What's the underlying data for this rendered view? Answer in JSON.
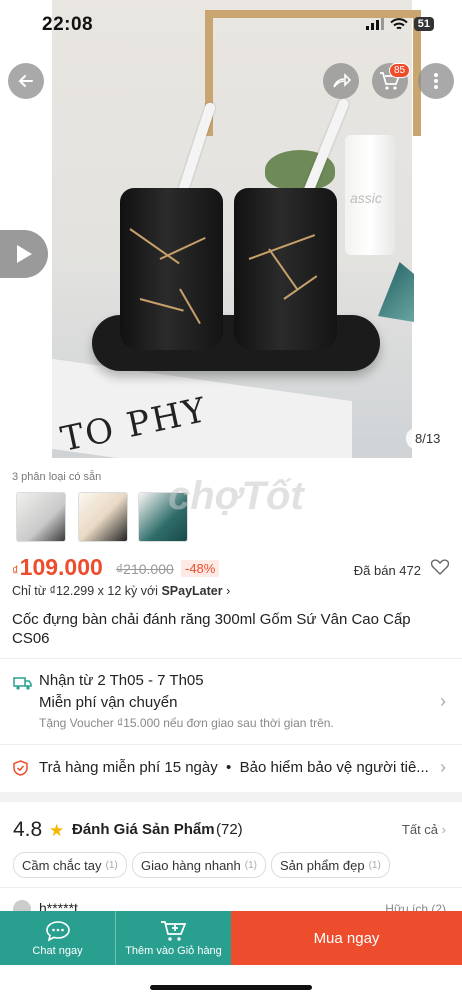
{
  "status_bar": {
    "time": "22:08",
    "battery": "51"
  },
  "gallery": {
    "counter": "8/13",
    "cart_badge": "85",
    "book_text": "TO PHY",
    "glass_text": "assic",
    "watermark": "chợTốt"
  },
  "variants": {
    "label": "3 phân loại có sẵn"
  },
  "price": {
    "currency": "₫",
    "current": "109.000",
    "original": "₫210.000",
    "discount": "-48%",
    "sold": "Đã bán 472"
  },
  "installment": {
    "prefix": "Chỉ từ ₫12.299 x 12 kỳ với ",
    "provider": "SPayLater",
    "arrow": "›"
  },
  "product": {
    "title": "Cốc đựng bàn chải đánh răng 300ml Gốm Sứ Vân Cao Cấp CS06"
  },
  "shipping": {
    "delivery": "Nhận từ 2 Th05 - 7 Th05",
    "free_ship": "Miễn phí vận chuyển",
    "voucher": "Tặng Voucher ₫15.000 nếu đơn giao sau thời gian trên."
  },
  "returns": {
    "text": "Trả hàng miễn phí 15 ngày  •  Bảo hiểm bảo vệ người tiê..."
  },
  "ratings": {
    "score": "4.8",
    "title": "Đánh Giá Sản Phẩm",
    "count": "(72)",
    "see_all": "Tất cả",
    "tags": [
      {
        "label": "Cầm chắc tay",
        "count": "(1)"
      },
      {
        "label": "Giao hàng nhanh",
        "count": "(1)"
      },
      {
        "label": "Sản phẩm đẹp",
        "count": "(1)"
      }
    ],
    "review_user": "h*****t",
    "helpful": "Hữu ích (2)"
  },
  "bottom_bar": {
    "chat": "Chat ngay",
    "add_cart": "Thêm vào Giỏ hàng",
    "buy": "Mua ngay"
  },
  "colors": {
    "brand": "#ee4d2d",
    "teal": "#29a08f"
  },
  "icons": [
    "back-arrow-icon",
    "share-icon",
    "cart-icon",
    "more-icon",
    "play-icon",
    "truck-icon",
    "shield-icon",
    "heart-icon",
    "star-icon",
    "chat-icon",
    "add-cart-icon"
  ]
}
